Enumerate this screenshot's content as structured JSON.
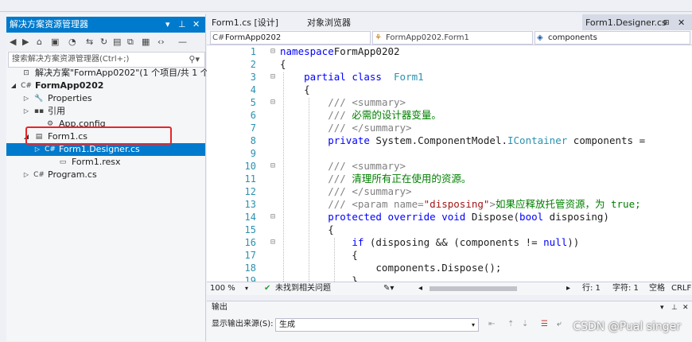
{
  "solution_explorer": {
    "title": "解决方案资源管理器",
    "title_controls": [
      "▾",
      "⊥",
      "✕"
    ],
    "search_placeholder": "搜索解决方案资源管理器(Ctrl+;)",
    "tree": [
      {
        "label": "解决方案\"FormApp0202\"(1 个项目/共 1 个)",
        "icon": "solution-icon",
        "expand": "",
        "bold": false
      },
      {
        "label": "FormApp0202",
        "icon": "csharp-project-icon",
        "expand": "◢",
        "bold": true
      },
      {
        "label": "Properties",
        "icon": "wrench-icon",
        "expand": "▷",
        "bold": false
      },
      {
        "label": "引用",
        "icon": "references-icon",
        "expand": "▷",
        "bold": false
      },
      {
        "label": "App.config",
        "icon": "config-file-icon",
        "expand": "",
        "bold": false
      },
      {
        "label": "Form1.cs",
        "icon": "form-icon",
        "expand": "◢",
        "bold": false
      },
      {
        "label": "Form1.Designer.cs",
        "icon": "csharp-file-icon",
        "expand": "▷",
        "bold": false,
        "selected": true
      },
      {
        "label": "Form1.resx",
        "icon": "resx-file-icon",
        "expand": "",
        "bold": false
      },
      {
        "label": "Program.cs",
        "icon": "csharp-file-icon",
        "expand": "▷",
        "bold": false
      }
    ]
  },
  "editor": {
    "tabs": [
      {
        "label": "Form1.cs [设计]"
      },
      {
        "label": "对象浏览器"
      },
      {
        "label": "Form1.Designer.cs",
        "active": true
      }
    ],
    "nav": {
      "project": "FormApp0202",
      "type": "FormApp0202.Form1",
      "member": "components"
    },
    "lines": [
      {
        "n": "1",
        "tokens": [
          [
            "kw",
            "namespace"
          ],
          [
            "",
            "FormApp0202"
          ]
        ]
      },
      {
        "n": "2",
        "tokens": [
          [
            "",
            "{"
          ]
        ]
      },
      {
        "n": "3",
        "tokens": [
          [
            "",
            "    "
          ],
          [
            "kw",
            "partial class"
          ],
          [
            "",
            "  "
          ],
          [
            "ty",
            "Form1"
          ]
        ]
      },
      {
        "n": "4",
        "tokens": [
          [
            "",
            "    {"
          ]
        ]
      },
      {
        "n": "5",
        "tokens": [
          [
            "",
            "        "
          ],
          [
            "xd",
            "/// <summary>"
          ]
        ]
      },
      {
        "n": "6",
        "tokens": [
          [
            "",
            "        "
          ],
          [
            "xd",
            "///"
          ],
          [
            "cm",
            " 必需的设计器变量。"
          ]
        ]
      },
      {
        "n": "7",
        "tokens": [
          [
            "",
            "        "
          ],
          [
            "xd",
            "/// </summary>"
          ]
        ]
      },
      {
        "n": "8",
        "tokens": [
          [
            "",
            "        "
          ],
          [
            "kw",
            "private"
          ],
          [
            "",
            " System.ComponentModel."
          ],
          [
            "ty",
            "IContainer"
          ],
          [
            "",
            " components ="
          ]
        ]
      },
      {
        "n": "9",
        "tokens": [
          [
            "",
            ""
          ]
        ]
      },
      {
        "n": "10",
        "tokens": [
          [
            "",
            "        "
          ],
          [
            "xd",
            "/// <summary>"
          ]
        ]
      },
      {
        "n": "11",
        "tokens": [
          [
            "",
            "        "
          ],
          [
            "xd",
            "///"
          ],
          [
            "cm",
            " 清理所有正在使用的资源。"
          ]
        ]
      },
      {
        "n": "12",
        "tokens": [
          [
            "",
            "        "
          ],
          [
            "xd",
            "/// </summary>"
          ]
        ]
      },
      {
        "n": "13",
        "tokens": [
          [
            "",
            "        "
          ],
          [
            "xd",
            "/// <param name="
          ],
          [
            "st",
            "\"disposing\""
          ],
          [
            "xd",
            ">"
          ],
          [
            "cm",
            "如果应释放托管资源，为 true;"
          ]
        ]
      },
      {
        "n": "14",
        "tokens": [
          [
            "",
            "        "
          ],
          [
            "kw",
            "protected override void"
          ],
          [
            "",
            " Dispose("
          ],
          [
            "kw",
            "bool"
          ],
          [
            "",
            " disposing)"
          ]
        ]
      },
      {
        "n": "15",
        "tokens": [
          [
            "",
            "        {"
          ]
        ]
      },
      {
        "n": "16",
        "tokens": [
          [
            "",
            "            "
          ],
          [
            "kw",
            "if"
          ],
          [
            "",
            " (disposing && (components != "
          ],
          [
            "kw",
            "null"
          ],
          [
            "",
            "))"
          ]
        ]
      },
      {
        "n": "17",
        "tokens": [
          [
            "",
            "            {"
          ]
        ]
      },
      {
        "n": "18",
        "tokens": [
          [
            "",
            "                components.Dispose();"
          ]
        ]
      },
      {
        "n": "19",
        "tokens": [
          [
            "",
            "            }"
          ]
        ]
      }
    ],
    "status": {
      "zoom": "100 %",
      "issues": "未找到相关问题",
      "line": "行: 1",
      "char": "字符: 1",
      "spaces": "空格",
      "eol": "CRLF"
    }
  },
  "output": {
    "title": "输出",
    "source_label": "显示输出来源(S):",
    "source_value": "生成"
  },
  "watermark": "CSDN @Pual singer"
}
